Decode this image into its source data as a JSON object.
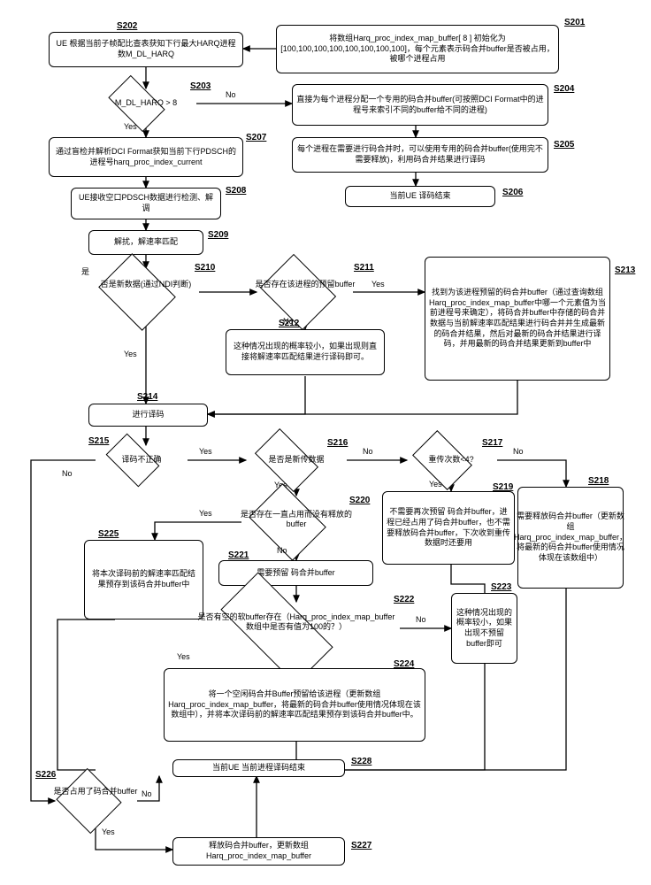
{
  "labels": {
    "s201": "S201",
    "s202": "S202",
    "s203": "S203",
    "s204": "S204",
    "s205": "S205",
    "s206": "S206",
    "s207": "S207",
    "s208": "S208",
    "s209": "S209",
    "s210": "S210",
    "s211": "S211",
    "s212": "S212",
    "s213": "S213",
    "s214": "S214",
    "s215": "S215",
    "s216": "S216",
    "s217": "S217",
    "s218": "S218",
    "s219": "S219",
    "s220": "S220",
    "s221": "S221",
    "s222": "S222",
    "s223": "S223",
    "s224": "S224",
    "s225": "S225",
    "s226": "S226",
    "s227": "S227",
    "s228": "S228"
  },
  "nodes": {
    "s201": "将数组Harq_proc_index_map_buffer[ 8 ] 初始化为[100,100,100,100,100,100,100,100]，每个元素表示码合并buffer是否被占用，被哪个进程占用",
    "s202": "UE 根据当前子帧配比查表获知下行最大HARQ进程数M_DL_HARQ",
    "s203": "M_DL_HARQ  >  8",
    "s204": "直接为每个进程分配一个专用的码合并buffer(可按照DCI Format中的进程号来索引不同的buffer给不同的进程)",
    "s205": "每个进程在需要进行码合并时，可以使用专用的码合并buffer(使用完不需要释放)，利用码合并结果进行译码",
    "s206": "当前UE 译码结束",
    "s207": "通过盲检并解析DCI Format获知当前下行PDSCH的进程号harq_proc_index_current",
    "s208": "UE接收空口PDSCH数据进行检测、解调",
    "s209": "解扰，解速率匹配",
    "s210": "否是新数据(通过NDI判断)",
    "s211": "是否存在该进程的预留buffer",
    "s212": "这种情况出现的概率较小，如果出现则直接将解速率匹配结果进行译码即可。",
    "s213": "找到为该进程预留的码合并buffer（通过查询数组Harq_proc_index_map_buffer中哪一个元素值为当前进程号来确定），将码合并buffer中存储的码合并数据与当前解速率匹配结果进行码合并并生成最新的码合并结果，然后对最新的码合并结果进行译码，并用最新的码合并结果更新到buffer中",
    "s214": "进行译码",
    "s215": "译码不正确",
    "s216": "是否是新传数据",
    "s217": "重传次数<4?",
    "s218": "需要释放码合并buffer（更新数组Harq_proc_index_map_buffer，将最新的码合并buffer使用情况体现在该数组中）",
    "s219": "不需要再次预留 码合并buffer，进程已经占用了码合并buffer，也不需要释放码合并buffer，下次收到重传数据时还要用",
    "s220": "是否存在一直占用而没有释放的buffer",
    "s221": "需要预留 码合并buffer",
    "s222": "是否有空的软buffer存在（Harq_proc_index_map_buffer数组中是否有值为100的？）",
    "s223": "这种情况出现的概率较小，如果出现不预留buffer即可",
    "s224": "将一个空闲码合并Buffer预留给该进程（更新数组Harq_proc_index_map_buffer，将最新的码合并buffer使用情况体现在该数组中），并将本次译码前的解速率匹配结果预存到该码合并buffer中。",
    "s225": "将本次译码前的解速率匹配结果预存到该码合并buffer中",
    "s226": "是否占用了码合并buffer",
    "s227": "释放码合并buffer，更新数组Harq_proc_index_map_buffer",
    "s228": "当前UE 当前进程译码结束"
  },
  "edges": {
    "yes": "Yes",
    "no": "No",
    "shi": "是"
  }
}
